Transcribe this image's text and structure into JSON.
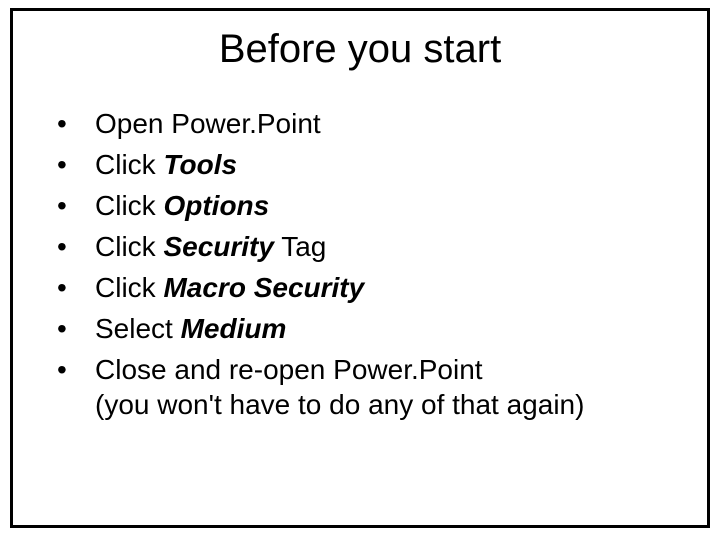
{
  "title": "Before you start",
  "bullets": {
    "b1": {
      "t1": "Open Power.Point"
    },
    "b2": {
      "t1": "Click ",
      "e1": "Tools"
    },
    "b3": {
      "t1": "Click ",
      "e1": "Options"
    },
    "b4": {
      "t1": "Click ",
      "e1": "Security",
      "t2": " Tag"
    },
    "b5": {
      "t1": "Click ",
      "e1": "Macro Security"
    },
    "b6": {
      "t1": "Select ",
      "e1": "Medium"
    },
    "b7": {
      "t1": "Close and re-open Power.Point",
      "sub": "(you won't have to do any of that again)"
    }
  }
}
